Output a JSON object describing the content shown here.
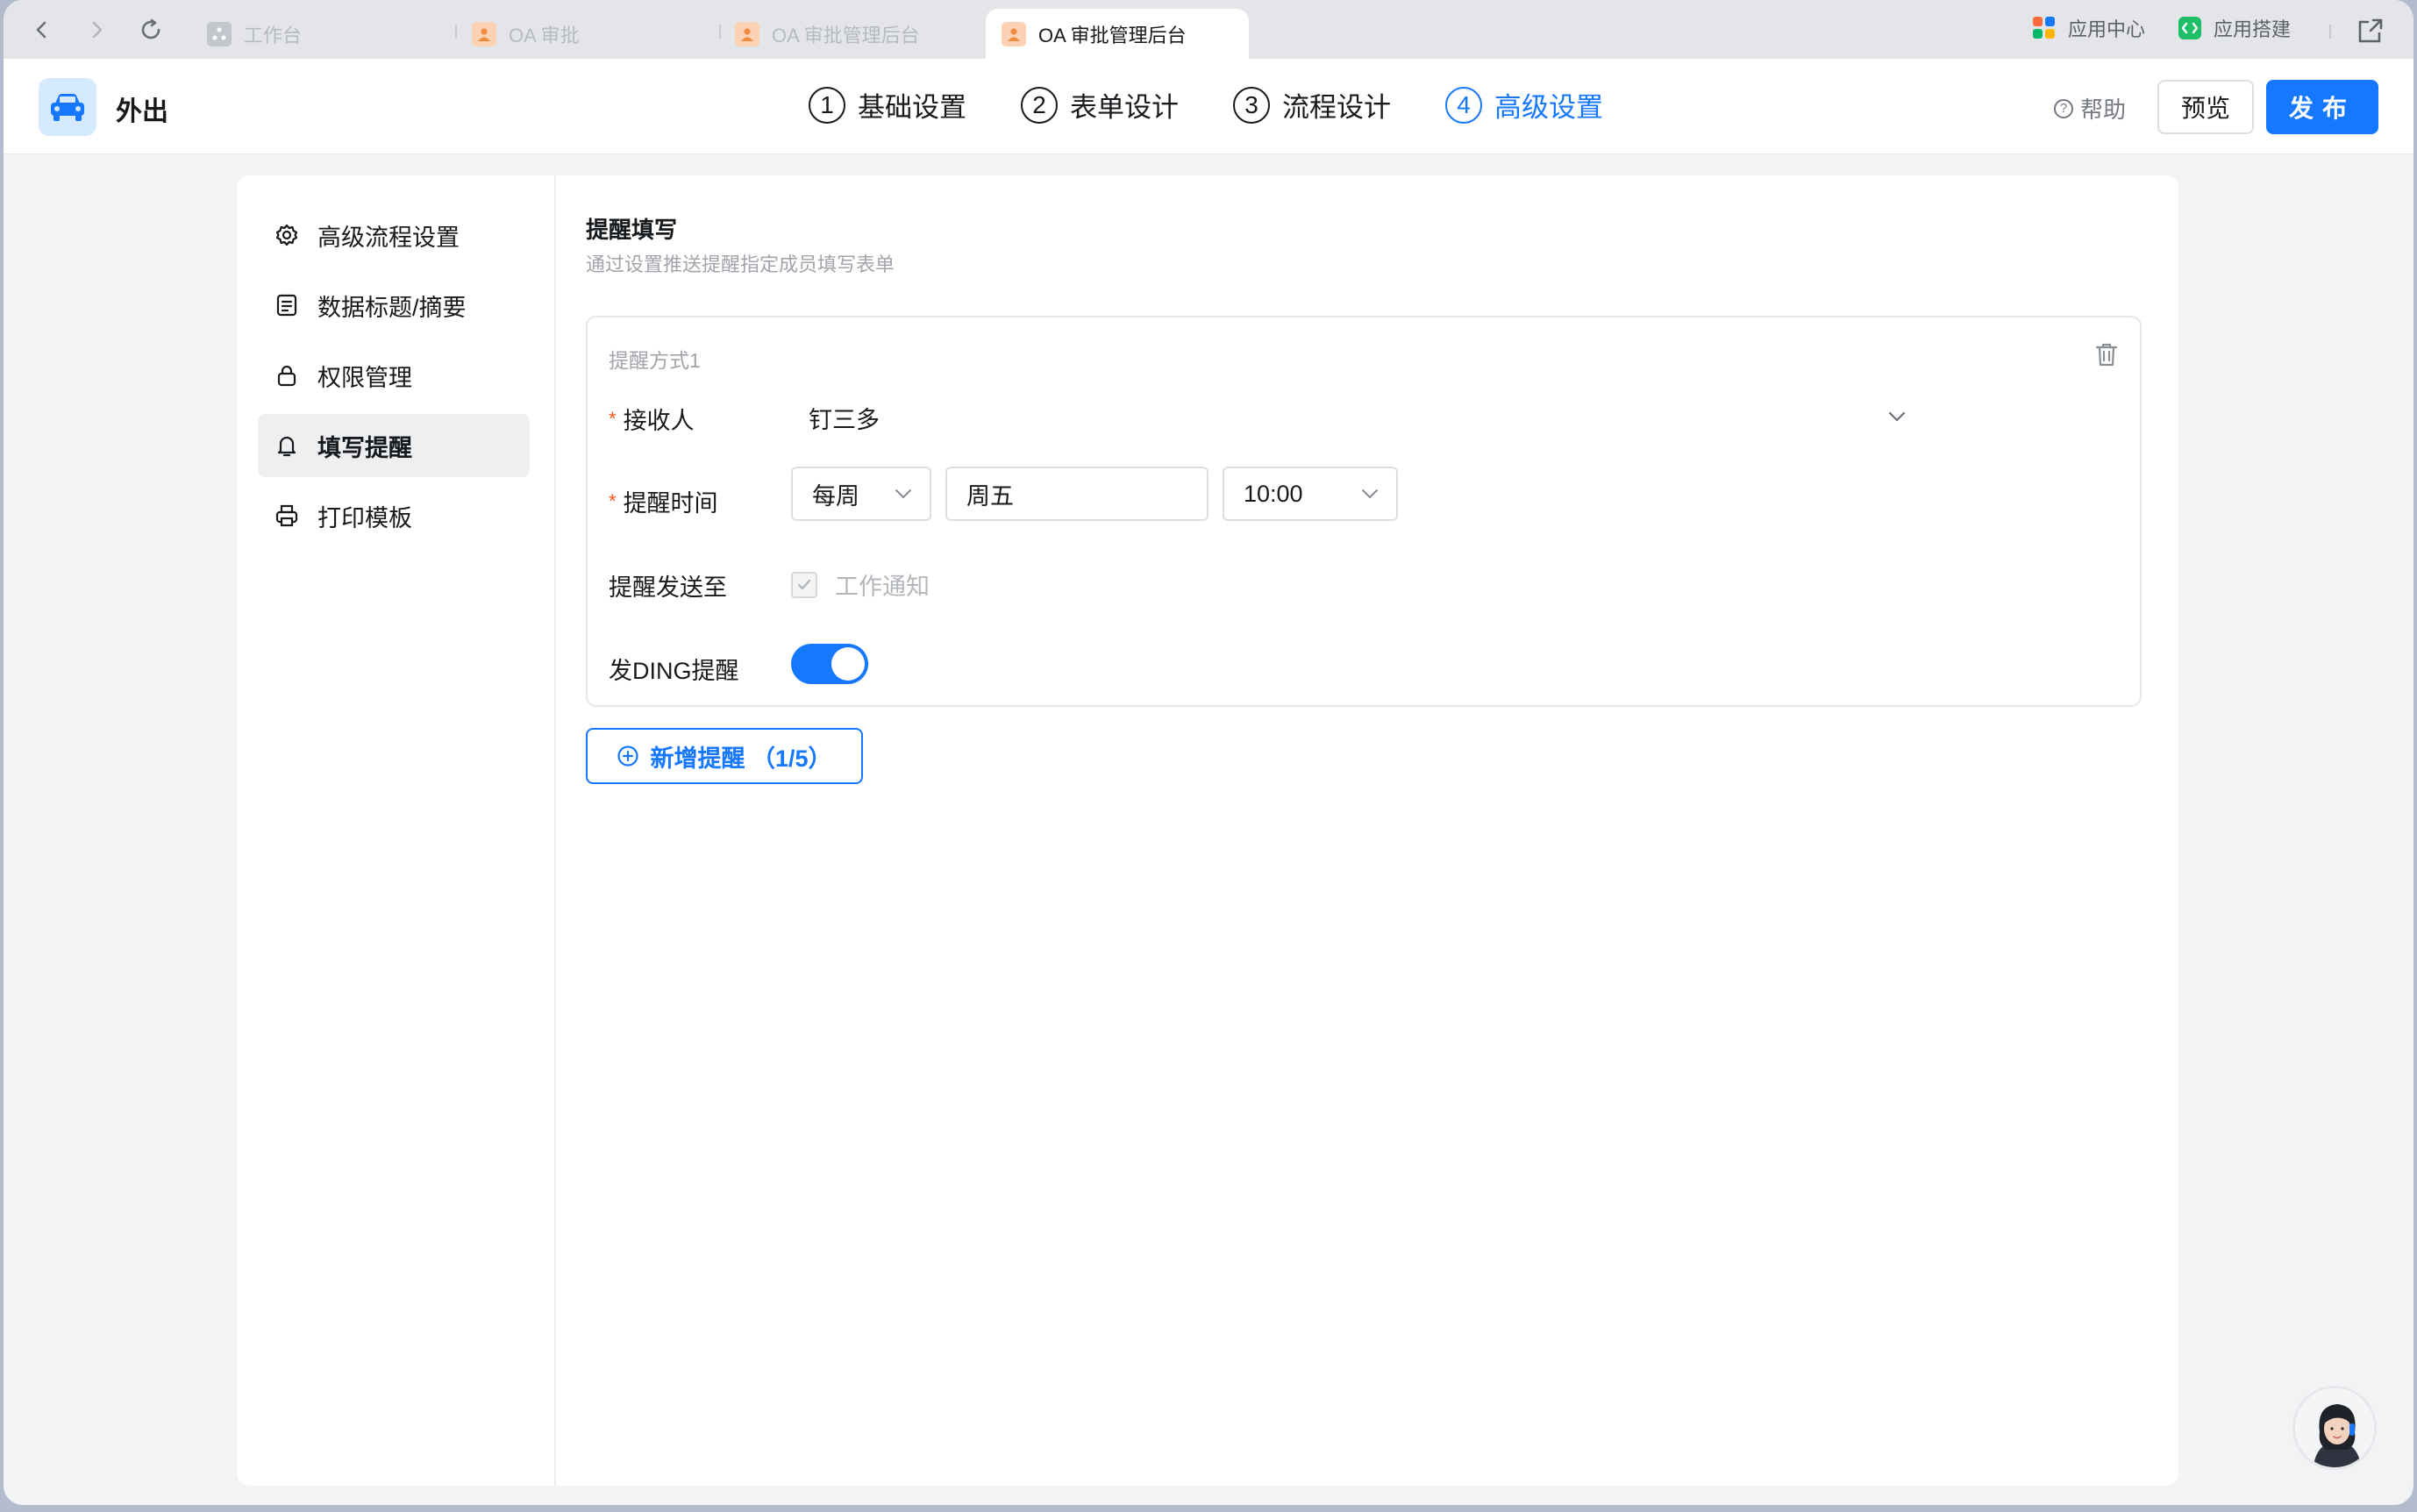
{
  "browser": {
    "tabs": [
      {
        "label": "工作台",
        "icon": "workbench-icon"
      },
      {
        "label": "OA 审批",
        "icon": "oa-app-icon"
      },
      {
        "label": "OA 审批管理后台",
        "icon": "oa-app-icon"
      },
      {
        "label": "OA 审批管理后台",
        "icon": "oa-app-icon"
      }
    ],
    "right_links": [
      "应用中心",
      "应用搭建"
    ]
  },
  "header": {
    "app_name": "外出",
    "app_icon": "car-icon",
    "steps": [
      {
        "num": "1",
        "label": "基础设置"
      },
      {
        "num": "2",
        "label": "表单设计"
      },
      {
        "num": "3",
        "label": "流程设计"
      },
      {
        "num": "4",
        "label": "高级设置"
      }
    ],
    "active_step": 4,
    "help_label": "帮助",
    "preview_label": "预览",
    "publish_label": "发布"
  },
  "sidebar": {
    "items": [
      {
        "label": "高级流程设置",
        "icon": "gear-icon"
      },
      {
        "label": "数据标题/摘要",
        "icon": "document-icon"
      },
      {
        "label": "权限管理",
        "icon": "lock-icon"
      },
      {
        "label": "填写提醒",
        "icon": "bell-icon"
      },
      {
        "label": "打印模板",
        "icon": "printer-icon"
      }
    ],
    "active_index": 3
  },
  "main": {
    "title": "提醒填写",
    "description": "通过设置推送提醒指定成员填写表单",
    "rule": {
      "title": "提醒方式1",
      "recipient_label": "接收人",
      "recipient_value": "钉三多",
      "time_label": "提醒时间",
      "frequency": "每周",
      "day": "周五",
      "time": "10:00",
      "send_to_label": "提醒发送至",
      "send_to_option": "工作通知",
      "send_to_checked": true,
      "ding_label": "发DING提醒",
      "ding_enabled": true
    },
    "add_button_label": "新增提醒 （1/5）"
  },
  "colors": {
    "accent": "#1677ff",
    "required": "#ff5219",
    "window_bg": "#f2f3f5"
  }
}
